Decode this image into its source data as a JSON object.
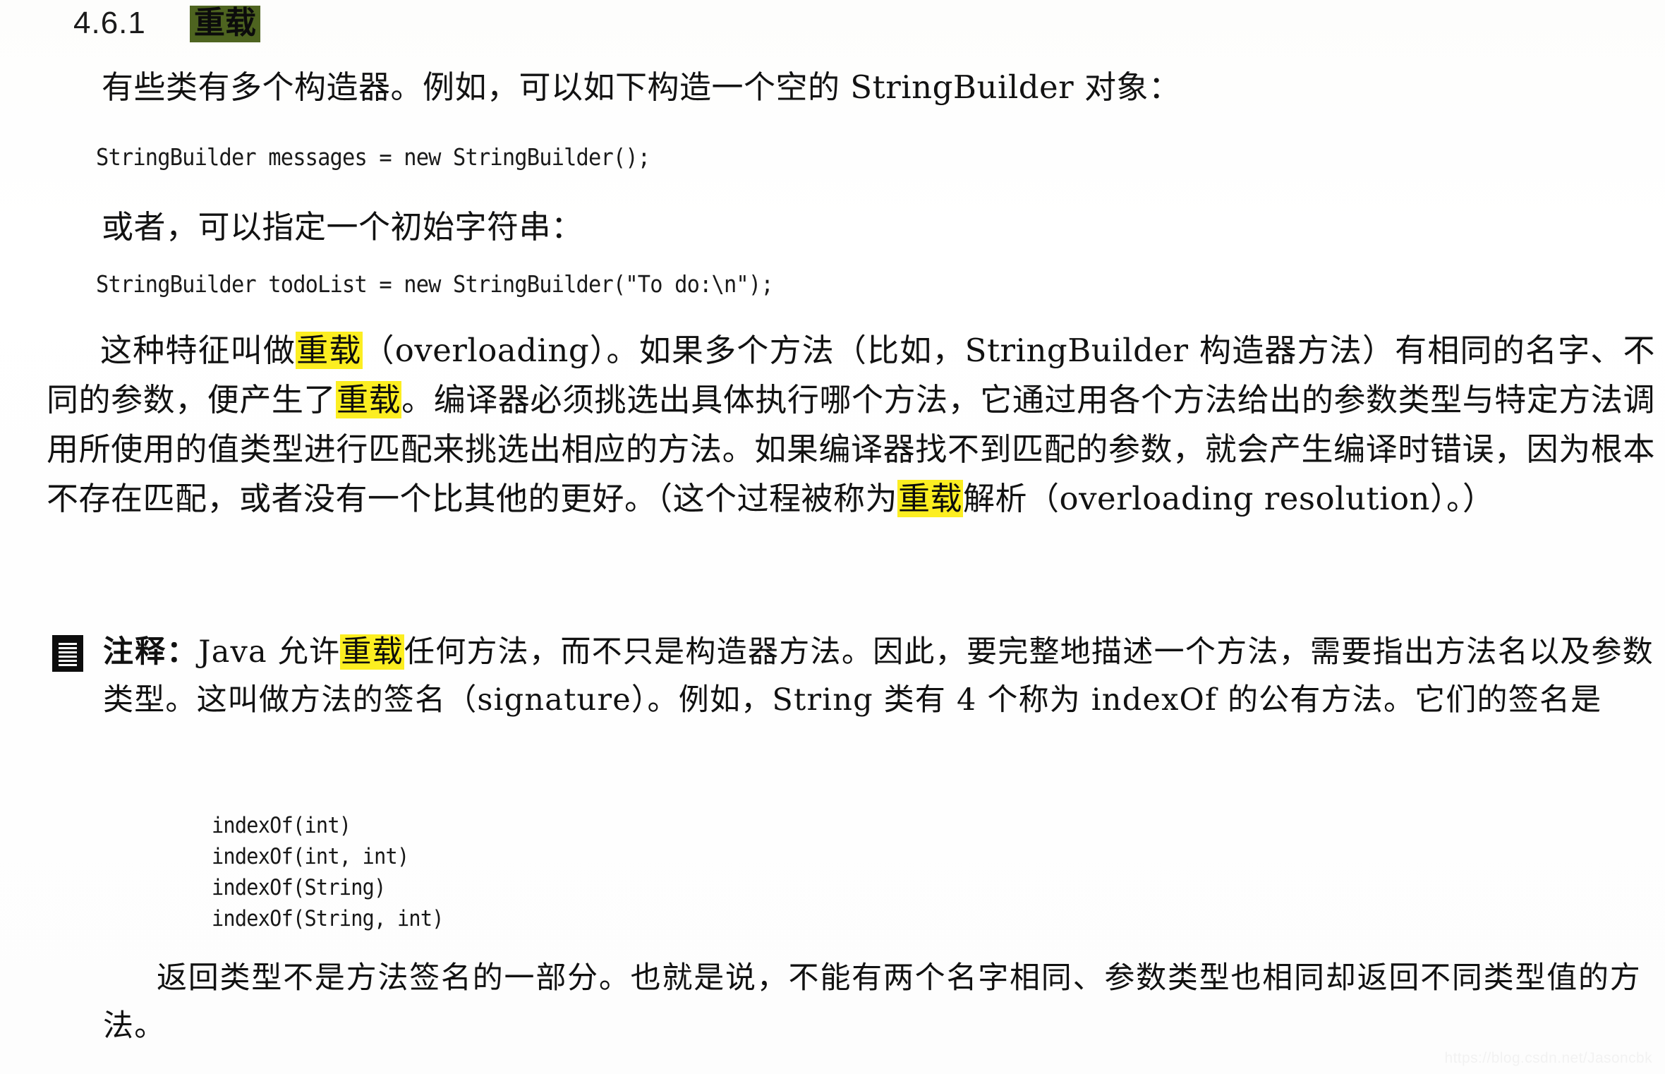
{
  "document": {
    "kind": "book-page-scan",
    "language": "zh-CN",
    "watermark": "https://blog.csdn.net/Jasoncbk"
  },
  "heading": {
    "number": "4.6.1",
    "title": "重载",
    "highlight_color": "#4e6420"
  },
  "highlight": {
    "yellow": "#fcee21",
    "olive": "#4e6420",
    "term": "重载"
  },
  "body": {
    "intro": "有些类有多个构造器。例如，可以如下构造一个空的 StringBuilder 对象：",
    "code_1": "StringBuilder messages = new StringBuilder();",
    "or_line": "或者，可以指定一个初始字符串：",
    "code_2": "StringBuilder todoList = new StringBuilder(\"To do:\\n\");",
    "main_paragraph": {
      "seg_1": "这种特征叫做",
      "hl_1": "重载",
      "seg_2": "（overloading）。如果多个方法（比如，StringBuilder 构造器方法）有相同的名字、不同的参数，便产生了",
      "hl_2": "重载",
      "seg_3": "。编译器必须挑选出具体执行哪个方法，它通过用各个方法给出的参数类型与特定方法调用所使用的值类型进行匹配来挑选出相应的方法。如果编译器找不到匹配的参数，就会产生编译时错误，因为根本不存在匹配，或者没有一个比其他的更好。（这个过程被称为",
      "hl_3": "重载",
      "seg_4": "解析（overloading resolution）。）"
    }
  },
  "note": {
    "icon": "note-document-icon",
    "label": "注释：",
    "seg_1": "Java 允许",
    "hl_1": "重载",
    "seg_2": "任何方法，而不只是构造器方法。因此，要完整地描述一个方法，需要指出方法名以及参数类型。这叫做方法的签名（signature）。例如，String 类有 4 个称为 indexOf 的公有方法。它们的签名是",
    "signatures": [
      "indexOf(int)",
      "indexOf(int, int)",
      "indexOf(String)",
      "indexOf(String, int)"
    ],
    "closing": "返回类型不是方法签名的一部分。也就是说，不能有两个名字相同、参数类型也相同却返回不同类型值的方法。"
  }
}
